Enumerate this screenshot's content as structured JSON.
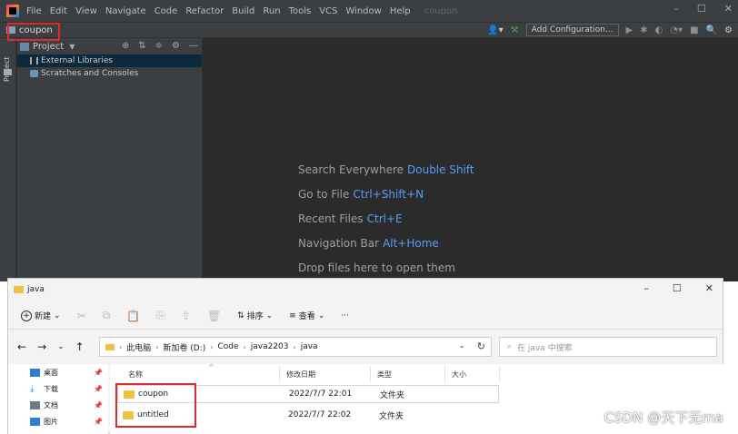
{
  "ide": {
    "menu": [
      "File",
      "Edit",
      "View",
      "Navigate",
      "Code",
      "Refactor",
      "Build",
      "Run",
      "Tools",
      "VCS",
      "Window",
      "Help"
    ],
    "project_name_faded": "coupon",
    "breadcrumb": "coupon",
    "toolbar": {
      "add_configuration": "Add Configuration..."
    },
    "project_panel": {
      "title": "Project",
      "side_tab": "Project",
      "tree": [
        {
          "label": "External Libraries"
        },
        {
          "label": "Scratches and Consoles"
        }
      ]
    },
    "welcome_hints": [
      {
        "label": "Search Everywhere",
        "shortcut": "Double Shift"
      },
      {
        "label": "Go to File",
        "shortcut": "Ctrl+Shift+N"
      },
      {
        "label": "Recent Files",
        "shortcut": "Ctrl+E"
      },
      {
        "label": "Navigation Bar",
        "shortcut": "Alt+Home"
      },
      {
        "label": "Drop files here to open them",
        "shortcut": ""
      }
    ]
  },
  "explorer": {
    "title": "java",
    "commands": {
      "new": "新建",
      "sort": "排序",
      "view": "查看",
      "more": "···"
    },
    "address": [
      "此电脑",
      "新加卷 (D:)",
      "Code",
      "java2203",
      "java"
    ],
    "search_placeholder": "在 java 中搜索",
    "nav_pane": [
      {
        "label": "桌面",
        "color": "#2f7fd1"
      },
      {
        "label": "下载",
        "color": "#2f7fd1"
      },
      {
        "label": "文档",
        "color": "#6a7b8c"
      },
      {
        "label": "图片",
        "color": "#2f7fd1"
      }
    ],
    "columns": [
      "名称",
      "修改日期",
      "类型",
      "大小"
    ],
    "files": [
      {
        "name": "coupon",
        "date": "2022/7/7 22:01",
        "type": "文件夹"
      },
      {
        "name": "untitled",
        "date": "2022/7/7 22:02",
        "type": "文件夹"
      }
    ]
  },
  "watermark": "CSDN @天下无ma"
}
